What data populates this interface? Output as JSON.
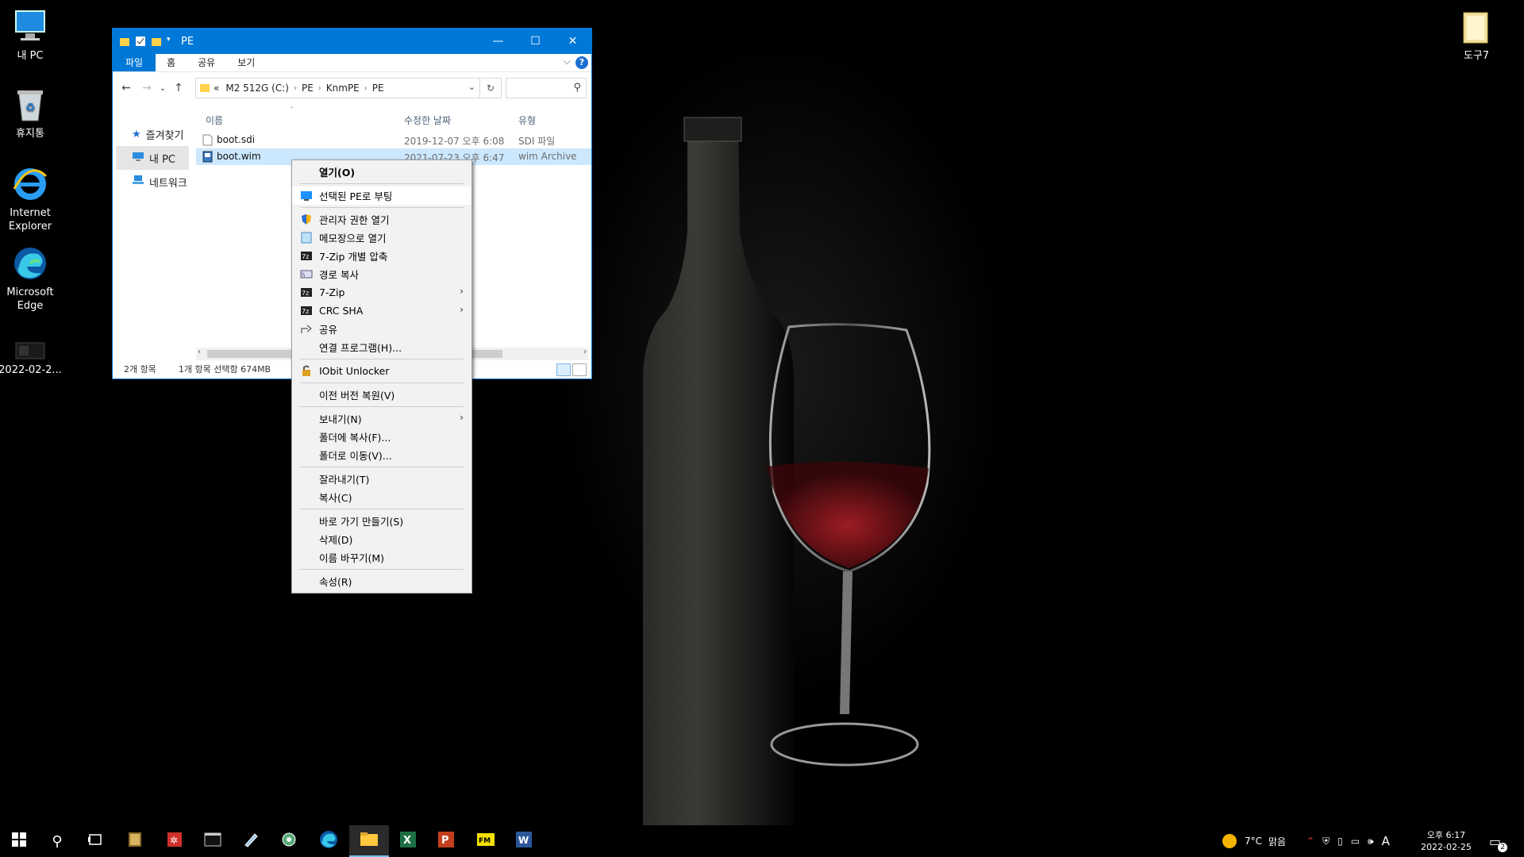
{
  "desktop": {
    "icons": [
      {
        "label": "내 PC"
      },
      {
        "label": "휴지통"
      },
      {
        "label": "Internet Explorer"
      },
      {
        "label": "Microsoft Edge"
      },
      {
        "label": "2022-02-2..."
      },
      {
        "label": "도구7"
      }
    ]
  },
  "explorer": {
    "title": "PE",
    "ribbon_tabs": [
      "파일",
      "홈",
      "공유",
      "보기"
    ],
    "help": "?",
    "address": {
      "prefix": "«",
      "crumbs": [
        "M2 512G (C:)",
        "PE",
        "KnmPE",
        "PE"
      ]
    },
    "nav": [
      {
        "label": "즐겨찾기",
        "icon": "star-icon"
      },
      {
        "label": "내 PC",
        "icon": "computer-icon"
      },
      {
        "label": "네트워크",
        "icon": "network-icon"
      }
    ],
    "columns": {
      "name": "이름",
      "modified": "수정한 날짜",
      "type": "유형"
    },
    "files": [
      {
        "name": "boot.sdi",
        "modified": "2019-12-07 오후 6:08",
        "type": "SDI 파일",
        "icon": "file-icon"
      },
      {
        "name": "boot.wim",
        "modified": "2021-07-23 오후 6:47",
        "type": "wim Archive",
        "icon": "archive-icon"
      }
    ],
    "status": {
      "count": "2개 항목",
      "selected": "1개 항목 선택함 674MB"
    }
  },
  "context_menu": {
    "groups": [
      [
        {
          "label": "열기(O)",
          "bold": true
        }
      ],
      [
        {
          "label": "선택된 PE로 부팅",
          "icon": "monitor-icon"
        }
      ],
      [
        {
          "label": "관리자 권한 열기",
          "icon": "shield-icon"
        },
        {
          "label": "메모장으로 열기",
          "icon": "notepad-icon"
        },
        {
          "label": "7-Zip 개별 압축",
          "icon": "7zip-icon"
        },
        {
          "label": "경로 복사",
          "icon": "path-icon"
        },
        {
          "label": "7-Zip",
          "icon": "7zip-icon",
          "submenu": true
        },
        {
          "label": "CRC SHA",
          "icon": "7zip-icon",
          "submenu": true
        },
        {
          "label": "공유",
          "icon": "share-icon"
        },
        {
          "label": "연결 프로그램(H)..."
        }
      ],
      [
        {
          "label": "IObit Unlocker",
          "icon": "lock-icon"
        }
      ],
      [
        {
          "label": "이전 버전 복원(V)"
        }
      ],
      [
        {
          "label": "보내기(N)",
          "submenu": true
        },
        {
          "label": "폴더에 복사(F)..."
        },
        {
          "label": "폴더로 이동(V)..."
        }
      ],
      [
        {
          "label": "잘라내기(T)"
        },
        {
          "label": "복사(C)"
        }
      ],
      [
        {
          "label": "바로 가기 만들기(S)"
        },
        {
          "label": "삭제(D)"
        },
        {
          "label": "이름 바꾸기(M)"
        }
      ],
      [
        {
          "label": "속성(R)"
        }
      ]
    ]
  },
  "taskbar": {
    "apps": [
      "start-icon",
      "search-icon",
      "task-view-icon",
      "winrar-icon",
      "tool-icon",
      "terminal-icon",
      "pen-icon",
      "settings-tool-icon",
      "edge-icon",
      "file-explorer-icon",
      "excel-icon",
      "powerpoint-icon",
      "fm-icon",
      "word-icon"
    ],
    "weather": {
      "temp": "7°C",
      "condition": "맑음"
    },
    "ime": "A",
    "time": "오후 6:17",
    "date": "2022-02-25",
    "notification_count": "2"
  },
  "colors": {
    "accent": "#0078d7",
    "selection": "#cce8ff"
  }
}
